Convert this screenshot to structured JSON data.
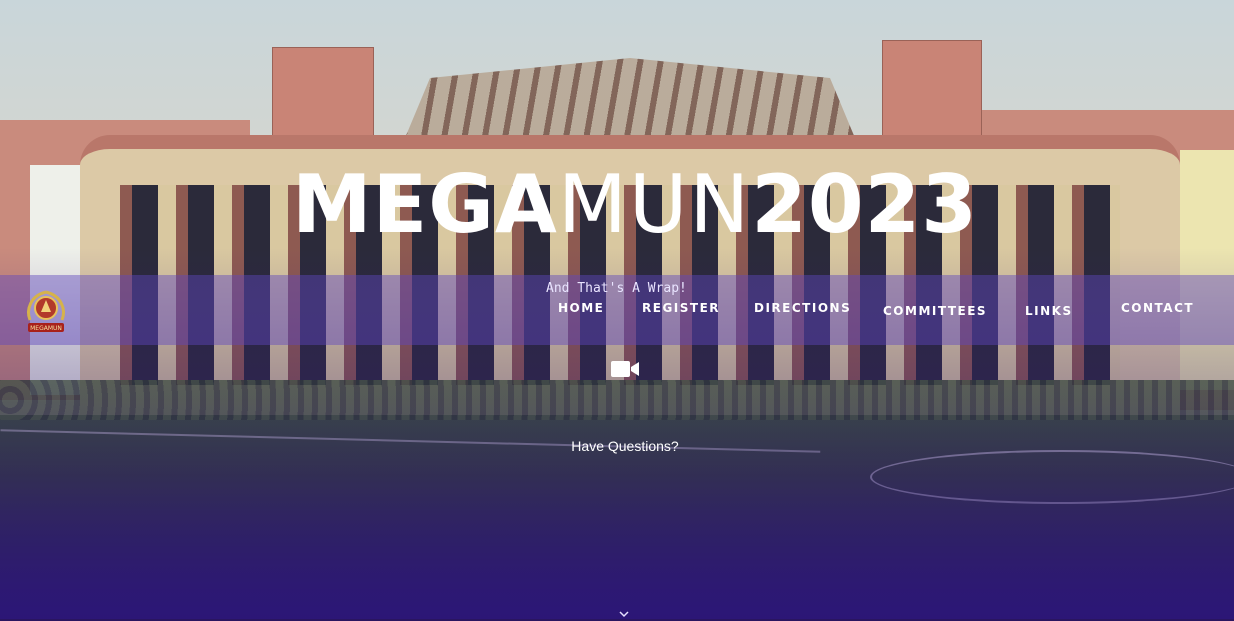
{
  "hero": {
    "title_bold_left": "MEGA",
    "title_thin": "MUN",
    "title_bold_right": "2023",
    "tagline": "And That's A Wrap!",
    "questions_label": "Have Questions?"
  },
  "logo": {
    "icon": "megamun-emblem-icon",
    "text": "MEGAMUN"
  },
  "nav": {
    "items": [
      {
        "label": "HOME"
      },
      {
        "label": "REGISTER"
      },
      {
        "label": "DIRECTIONS"
      },
      {
        "label": "COMMITTEES"
      },
      {
        "label": "LINKS"
      },
      {
        "label": "CONTACT"
      }
    ]
  },
  "icons": {
    "video": "video-camera-icon",
    "scroll": "chevron-down-icon"
  },
  "colors": {
    "nav_band": "#5f46be",
    "bottom_fade": "#2c166e",
    "text": "#ffffff"
  }
}
